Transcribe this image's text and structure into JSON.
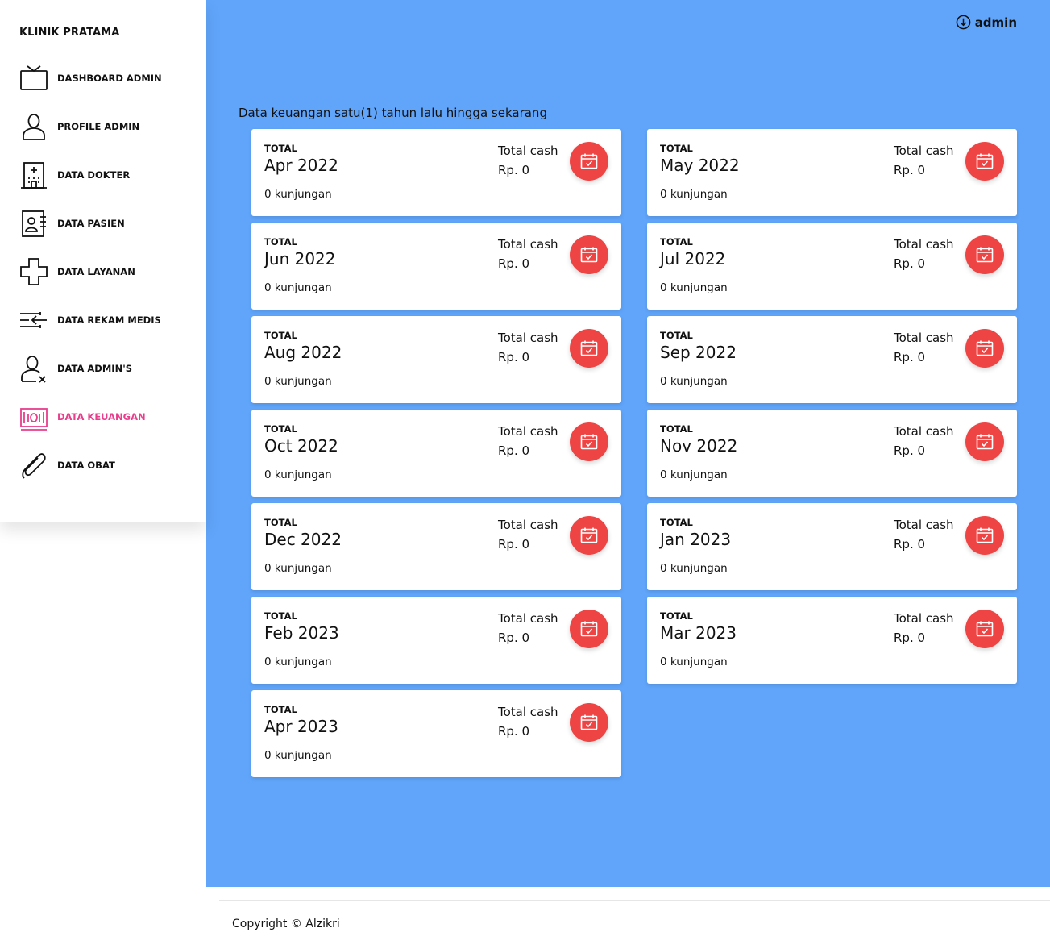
{
  "sidebar": {
    "brand": "KLINIK PRATAMA",
    "items": [
      {
        "label": "DASHBOARD ADMIN",
        "icon": "tv-icon"
      },
      {
        "label": "PROFILE ADMIN",
        "icon": "user-icon"
      },
      {
        "label": "DATA DOKTER",
        "icon": "hospital-icon"
      },
      {
        "label": "DATA PASIEN",
        "icon": "id-card-icon"
      },
      {
        "label": "DATA LAYANAN",
        "icon": "medical-cross-icon"
      },
      {
        "label": "DATA REKAM MEDIS",
        "icon": "records-icon"
      },
      {
        "label": "DATA ADMIN'S",
        "icon": "user-remove-icon"
      },
      {
        "label": "DATA KEUANGAN",
        "icon": "money-icon",
        "active": true
      },
      {
        "label": "DATA OBAT",
        "icon": "paperclip-icon"
      }
    ]
  },
  "header": {
    "user": "admin",
    "user_icon": "arrow-down-circle-icon"
  },
  "main": {
    "subtitle": "Data keuangan satu(1) tahun lalu hingga sekarang",
    "cards": [
      {
        "total_label": "TOTAL",
        "month": "Apr 2022",
        "visits": "0 kunjungan",
        "cash_label": "Total cash",
        "cash_value": "Rp. 0"
      },
      {
        "total_label": "TOTAL",
        "month": "May 2022",
        "visits": "0 kunjungan",
        "cash_label": "Total cash",
        "cash_value": "Rp. 0"
      },
      {
        "total_label": "TOTAL",
        "month": "Jun 2022",
        "visits": "0 kunjungan",
        "cash_label": "Total cash",
        "cash_value": "Rp. 0"
      },
      {
        "total_label": "TOTAL",
        "month": "Jul 2022",
        "visits": "0 kunjungan",
        "cash_label": "Total cash",
        "cash_value": "Rp. 0"
      },
      {
        "total_label": "TOTAL",
        "month": "Aug 2022",
        "visits": "0 kunjungan",
        "cash_label": "Total cash",
        "cash_value": "Rp. 0"
      },
      {
        "total_label": "TOTAL",
        "month": "Sep 2022",
        "visits": "0 kunjungan",
        "cash_label": "Total cash",
        "cash_value": "Rp. 0"
      },
      {
        "total_label": "TOTAL",
        "month": "Oct 2022",
        "visits": "0 kunjungan",
        "cash_label": "Total cash",
        "cash_value": "Rp. 0"
      },
      {
        "total_label": "TOTAL",
        "month": "Nov 2022",
        "visits": "0 kunjungan",
        "cash_label": "Total cash",
        "cash_value": "Rp. 0"
      },
      {
        "total_label": "TOTAL",
        "month": "Dec 2022",
        "visits": "0 kunjungan",
        "cash_label": "Total cash",
        "cash_value": "Rp. 0"
      },
      {
        "total_label": "TOTAL",
        "month": "Jan 2023",
        "visits": "0 kunjungan",
        "cash_label": "Total cash",
        "cash_value": "Rp. 0"
      },
      {
        "total_label": "TOTAL",
        "month": "Feb 2023",
        "visits": "0 kunjungan",
        "cash_label": "Total cash",
        "cash_value": "Rp. 0"
      },
      {
        "total_label": "TOTAL",
        "month": "Mar 2023",
        "visits": "0 kunjungan",
        "cash_label": "Total cash",
        "cash_value": "Rp. 0"
      },
      {
        "total_label": "TOTAL",
        "month": "Apr 2023",
        "visits": "0 kunjungan",
        "cash_label": "Total cash",
        "cash_value": "Rp. 0"
      }
    ],
    "card_icon": "calendar-check-icon"
  },
  "footer": {
    "copyright": "Copyright © Alzikri"
  },
  "colors": {
    "main_bg": "#60a5fa",
    "accent_red": "#ef4444",
    "active_pink": "#e83e8c"
  }
}
